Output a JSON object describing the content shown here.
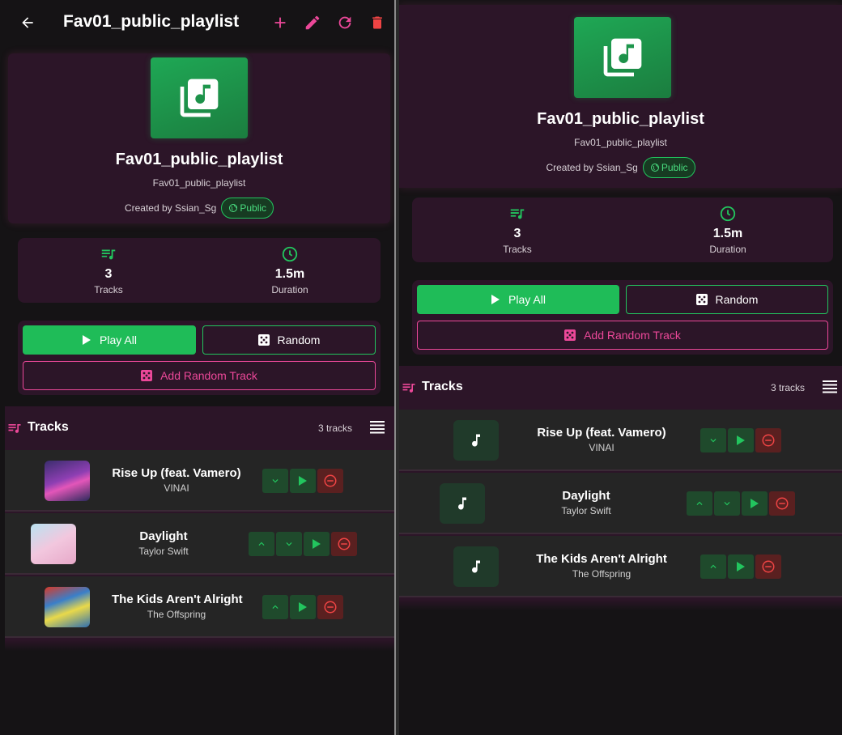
{
  "playlist": {
    "title": "Fav01_public_playlist",
    "description": "Fav01_public_playlist",
    "created_by": "Created by Ssian_Sg",
    "visibility": "Public"
  },
  "stats": {
    "tracks_value": "3",
    "tracks_label": "Tracks",
    "duration_value": "1.5m",
    "duration_label": "Duration"
  },
  "actions": {
    "play_all": "Play All",
    "random": "Random",
    "add_random": "Add Random Track"
  },
  "tracks_section": {
    "title": "Tracks",
    "count": "3 tracks"
  },
  "tracks": [
    {
      "name": "Rise Up (feat. Vamero)",
      "artist": "VINAI"
    },
    {
      "name": "Daylight",
      "artist": "Taylor Swift"
    },
    {
      "name": "The Kids Aren't Alright",
      "artist": "The Offspring"
    }
  ],
  "colors": {
    "accent_green": "#1fbc58",
    "accent_pink": "#ec4899",
    "card_bg": "#2c1528",
    "delete_red": "#ef4444"
  },
  "icons": {
    "back": "arrow-left-icon",
    "add": "plus-icon",
    "edit": "pencil-icon",
    "refresh": "refresh-icon",
    "delete": "trash-icon",
    "cover": "library-music-icon",
    "public": "globe-icon",
    "tracks_stat": "playlist-music-icon",
    "duration_stat": "clock-icon",
    "play": "play-icon",
    "random": "dice-icon",
    "tracks_header": "playlist-music-icon",
    "view_toggle": "list-icon",
    "move_up": "chevron-up-icon",
    "move_down": "chevron-down-icon",
    "remove": "minus-circle-icon",
    "note": "music-note-icon"
  }
}
